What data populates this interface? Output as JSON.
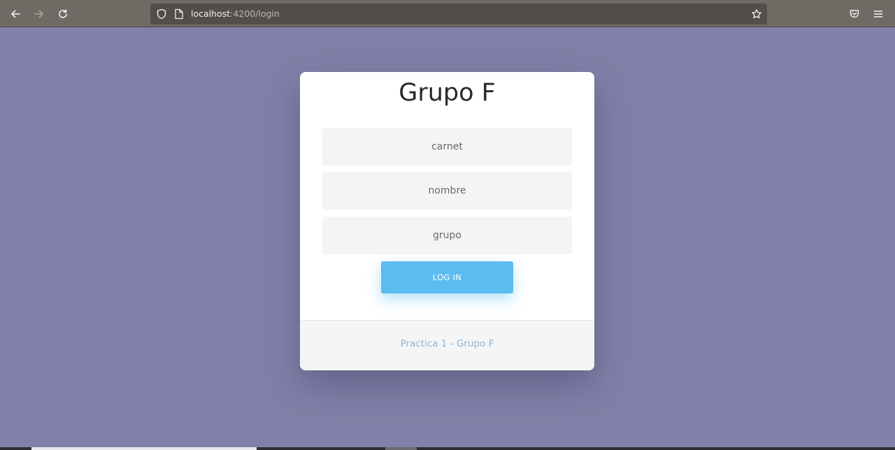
{
  "browser": {
    "url_host": "localhost",
    "url_rest": ":4200/login"
  },
  "card": {
    "title": "Grupo F",
    "fields": [
      {
        "placeholder": "carnet",
        "value": ""
      },
      {
        "placeholder": "nombre",
        "value": ""
      },
      {
        "placeholder": "grupo",
        "value": ""
      }
    ],
    "button_label": "LOG IN",
    "footer_link": "Practica 1 - Grupo F"
  },
  "colors": {
    "page_background": "#8080a8",
    "button": "#5bbcef",
    "footer_link": "#8fb3d6"
  }
}
